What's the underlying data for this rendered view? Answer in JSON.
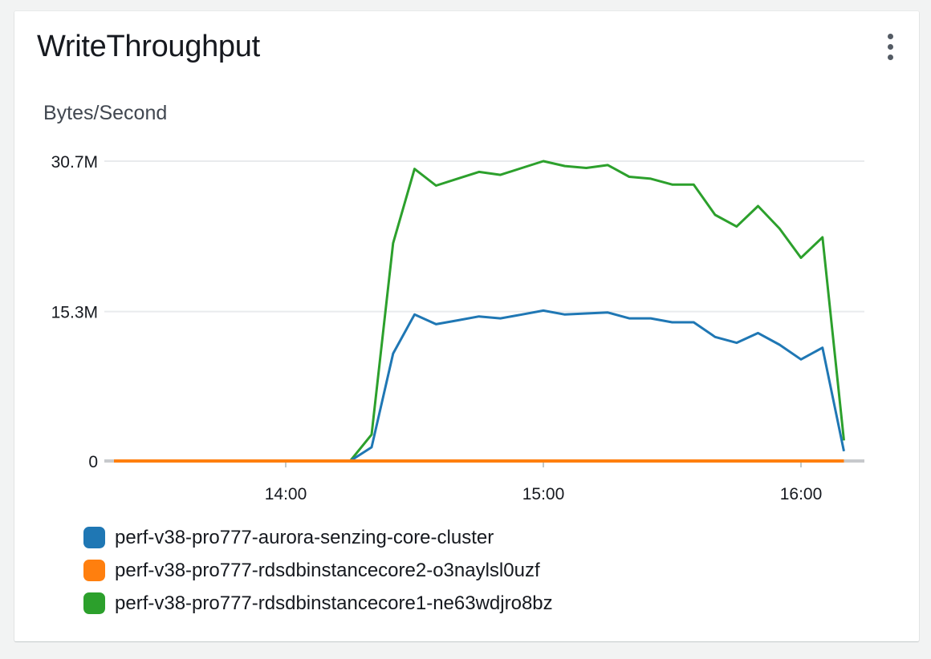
{
  "widget": {
    "title": "WriteThroughput",
    "menu_icon": "more-vertical-icon"
  },
  "chart_data": {
    "type": "line",
    "title": "WriteThroughput",
    "ylabel": "Bytes/Second",
    "xlabel": "",
    "y_ticks": [
      {
        "value": 0,
        "label": "0"
      },
      {
        "value": 15300000,
        "label": "15.3M"
      },
      {
        "value": 30700000,
        "label": "30.7M"
      }
    ],
    "x_ticks": [
      {
        "value": "14:00",
        "label": "14:00"
      },
      {
        "value": "15:00",
        "label": "15:00"
      },
      {
        "value": "16:00",
        "label": "16:00"
      }
    ],
    "x_range": [
      "13:20",
      "16:35"
    ],
    "ylim": [
      0,
      30700000
    ],
    "grid": "horizontal",
    "legend_position": "bottom",
    "x": [
      "13:20",
      "13:25",
      "13:30",
      "13:35",
      "13:40",
      "13:45",
      "13:50",
      "13:55",
      "14:00",
      "14:05",
      "14:10",
      "14:15",
      "14:20",
      "14:25",
      "14:30",
      "14:35",
      "14:40",
      "14:45",
      "14:50",
      "14:55",
      "15:00",
      "15:05",
      "15:10",
      "15:15",
      "15:20",
      "15:25",
      "15:30",
      "15:35",
      "15:40",
      "15:45",
      "15:50",
      "15:55",
      "16:00",
      "16:05",
      "16:10"
    ],
    "series": [
      {
        "name": "perf-v38-pro777-aurora-senzing-core-cluster",
        "color": "#1f77b4",
        "values": [
          0,
          0,
          0,
          0,
          0,
          0,
          0,
          0,
          0,
          0,
          0,
          0,
          1400000,
          11000000,
          15000000,
          14000000,
          14400000,
          14800000,
          14600000,
          15000000,
          15400000,
          15000000,
          15100000,
          15200000,
          14600000,
          14600000,
          14200000,
          14200000,
          12700000,
          12100000,
          13100000,
          11900000,
          10400000,
          11600000,
          1000000,
          0
        ]
      },
      {
        "name": "perf-v38-pro777-rdsdbinstancecore2-o3naylsl0uzf",
        "color": "#ff7f0e",
        "values": [
          0,
          0,
          0,
          0,
          0,
          0,
          0,
          0,
          0,
          0,
          0,
          0,
          0,
          0,
          0,
          0,
          0,
          0,
          0,
          0,
          0,
          0,
          0,
          0,
          0,
          0,
          0,
          0,
          0,
          0,
          0,
          0,
          0,
          0,
          0,
          0
        ]
      },
      {
        "name": "perf-v38-pro777-rdsdbinstancecore1-ne63wdjro8bz",
        "color": "#2ca02c",
        "values": [
          0,
          0,
          0,
          0,
          0,
          0,
          0,
          0,
          0,
          0,
          0,
          0,
          2700000,
          22300000,
          29900000,
          28200000,
          28900000,
          29600000,
          29300000,
          30000000,
          30700000,
          30200000,
          30000000,
          30300000,
          29100000,
          28900000,
          28300000,
          28300000,
          25200000,
          24000000,
          26100000,
          23800000,
          20800000,
          22900000,
          2100000,
          0
        ]
      }
    ]
  }
}
